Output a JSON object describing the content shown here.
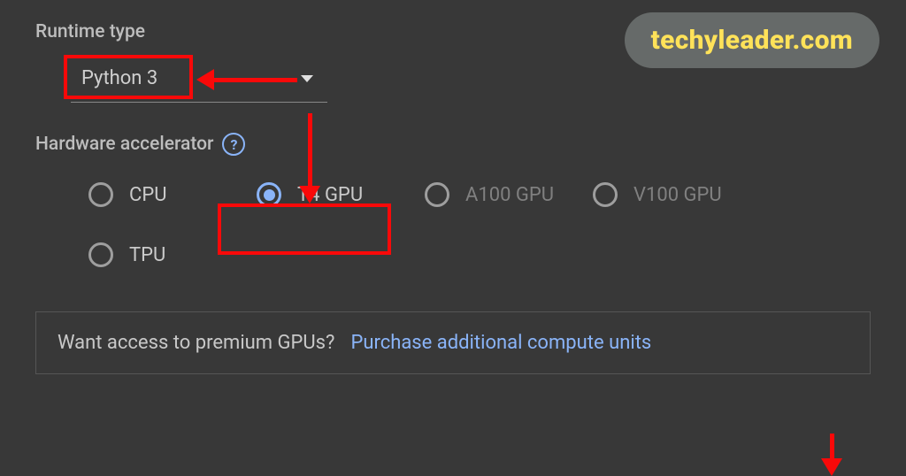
{
  "watermark": "techyleader.com",
  "runtime": {
    "label": "Runtime type",
    "selected": "Python 3"
  },
  "accelerator": {
    "label": "Hardware accelerator",
    "options": [
      {
        "label": "CPU",
        "selected": false,
        "dim": false
      },
      {
        "label": "T4 GPU",
        "selected": true,
        "dim": false
      },
      {
        "label": "A100 GPU",
        "selected": false,
        "dim": true
      },
      {
        "label": "V100 GPU",
        "selected": false,
        "dim": true
      },
      {
        "label": "TPU",
        "selected": false,
        "dim": false
      }
    ]
  },
  "premium": {
    "question": "Want access to premium GPUs?",
    "link": "Purchase additional compute units"
  },
  "annotation_colors": {
    "highlight": "#f90909"
  }
}
